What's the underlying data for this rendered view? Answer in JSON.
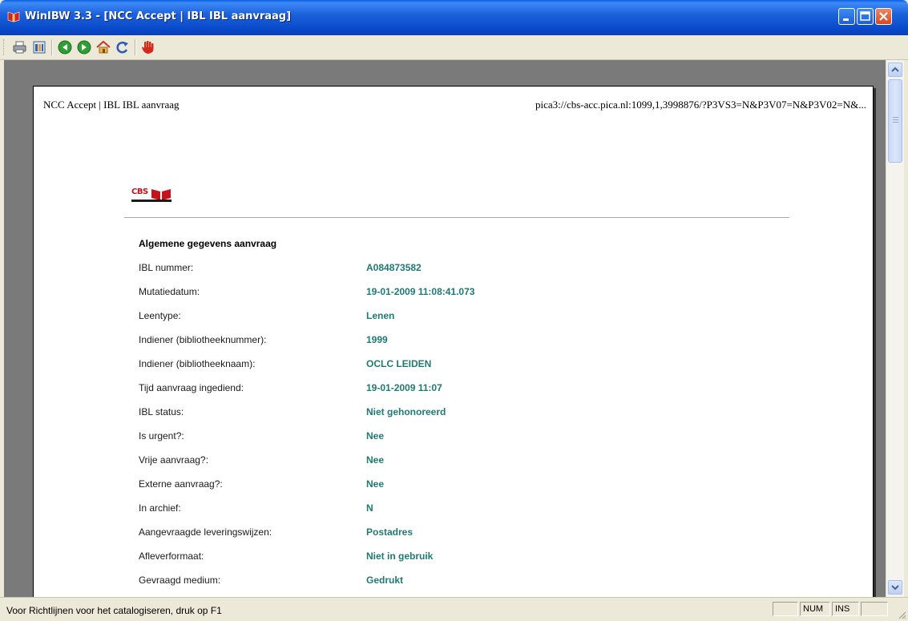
{
  "window": {
    "title": "WinIBW 3.3 - [NCC Accept | IBL IBL aanvraag]"
  },
  "toolbar": {
    "icons": [
      "print-icon",
      "settings-icon",
      "back-icon",
      "forward-icon",
      "home-icon",
      "refresh-icon",
      "stop-hand-icon"
    ]
  },
  "page": {
    "header_left": "NCC Accept | IBL IBL aanvraag",
    "header_right": "pica3://cbs-acc.pica.nl:1099,1,3998876/?P3VS3=N&P3V07=N&P3V02=N&...",
    "logo_text": "CBS",
    "section_title": "Algemene gegevens aanvraag",
    "rows": [
      {
        "label": "IBL nummer:",
        "value": "A084873582"
      },
      {
        "label": "Mutatiedatum:",
        "value": "19-01-2009 11:08:41.073"
      },
      {
        "label": "Leentype:",
        "value": "Lenen"
      },
      {
        "label": "Indiener (bibliotheeknummer):",
        "value": "1999"
      },
      {
        "label": "Indiener (bibliotheeknaam):",
        "value": "OCLC LEIDEN"
      },
      {
        "label": "Tijd aanvraag ingediend:",
        "value": "19-01-2009 11:07"
      },
      {
        "label": "IBL status:",
        "value": "Niet gehonoreerd"
      },
      {
        "label": "Is urgent?:",
        "value": "Nee"
      },
      {
        "label": "Vrije aanvraag?:",
        "value": "Nee"
      },
      {
        "label": "Externe aanvraag?:",
        "value": "Nee"
      },
      {
        "label": "In archief:",
        "value": "N"
      },
      {
        "label": "Aangevraagde leveringswijzen:",
        "value": "Postadres"
      },
      {
        "label": "Afleverformaat:",
        "value": "Niet in gebruik"
      },
      {
        "label": "Gevraagd medium:",
        "value": "Gedrukt"
      }
    ]
  },
  "statusbar": {
    "message": "Voor Richtlijnen voor het catalogiseren, druk op F1",
    "num": "NUM",
    "ins": "INS"
  },
  "colors": {
    "title_bar": "#0a5fe3",
    "value_text": "#1e7a72",
    "logo_red": "#c4131b"
  }
}
